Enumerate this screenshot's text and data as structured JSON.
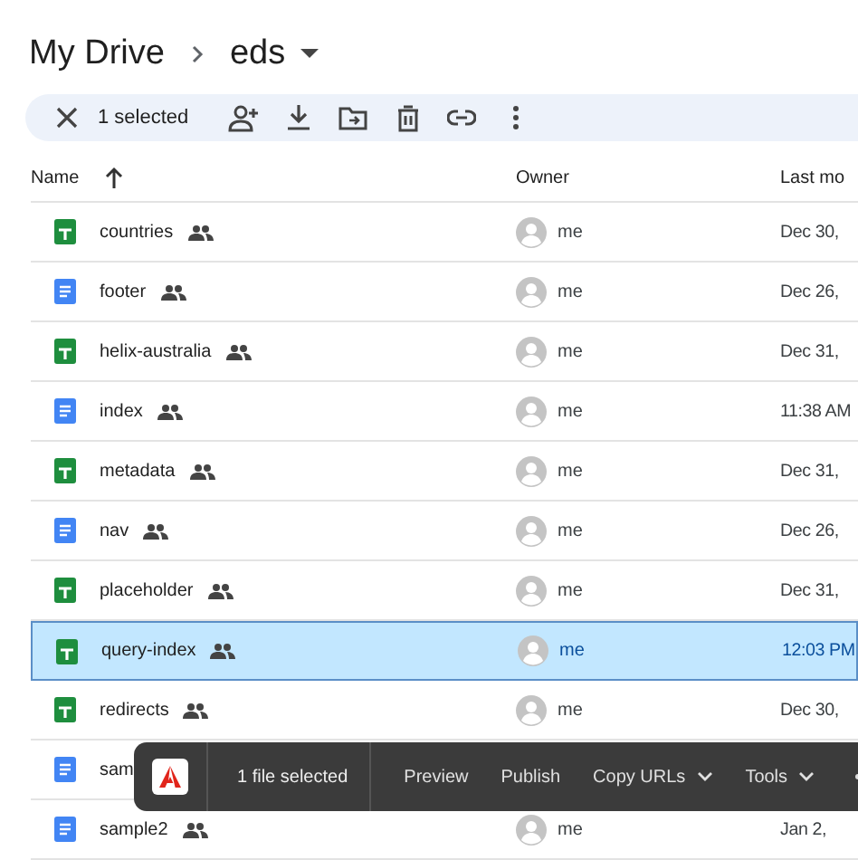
{
  "breadcrumb": {
    "parent": "My Drive",
    "current": "eds"
  },
  "selection_bar": {
    "count_label": "1 selected"
  },
  "columns": {
    "name": "Name",
    "owner": "Owner",
    "modified": "Last mo"
  },
  "rows": [
    {
      "name": "countries",
      "kind": "sheet",
      "shared": true,
      "owner": "me",
      "modified": "Dec 30,",
      "selected": false
    },
    {
      "name": "footer",
      "kind": "doc",
      "shared": true,
      "owner": "me",
      "modified": "Dec 26,",
      "selected": false
    },
    {
      "name": "helix-australia",
      "kind": "sheet",
      "shared": true,
      "owner": "me",
      "modified": "Dec 31,",
      "selected": false
    },
    {
      "name": "index",
      "kind": "doc",
      "shared": true,
      "owner": "me",
      "modified": "11:38 AM",
      "selected": false
    },
    {
      "name": "metadata",
      "kind": "sheet",
      "shared": true,
      "owner": "me",
      "modified": "Dec 31,",
      "selected": false
    },
    {
      "name": "nav",
      "kind": "doc",
      "shared": true,
      "owner": "me",
      "modified": "Dec 26,",
      "selected": false
    },
    {
      "name": "placeholder",
      "kind": "sheet",
      "shared": true,
      "owner": "me",
      "modified": "Dec 31,",
      "selected": false
    },
    {
      "name": "query-index",
      "kind": "sheet",
      "shared": true,
      "owner": "me",
      "modified": "12:03 PM",
      "selected": true
    },
    {
      "name": "redirects",
      "kind": "sheet",
      "shared": true,
      "owner": "me",
      "modified": "Dec 30,",
      "selected": false
    },
    {
      "name": "sam",
      "kind": "doc",
      "selected": false
    },
    {
      "name": "sample2",
      "kind": "doc",
      "shared": true,
      "owner": "me",
      "modified": "Jan 2,",
      "selected": false
    }
  ],
  "toolbar": {
    "count_label": "1 file selected",
    "actions": [
      {
        "label": "Preview",
        "menu": false
      },
      {
        "label": "Publish",
        "menu": false
      },
      {
        "label": "Copy URLs",
        "menu": true
      },
      {
        "label": "Tools",
        "menu": true
      }
    ]
  }
}
